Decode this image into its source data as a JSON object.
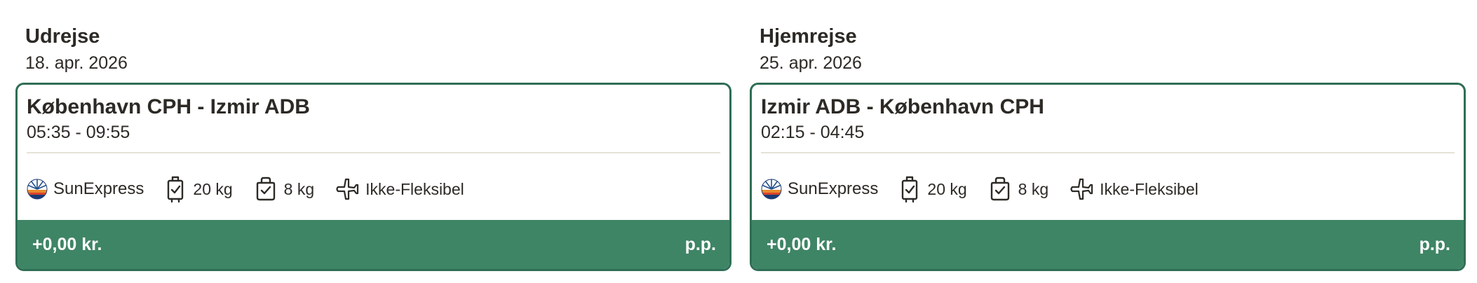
{
  "outbound": {
    "heading": "Udrejse",
    "date": "18. apr. 2026",
    "route": "København CPH - Izmir ADB",
    "times": "05:35 - 09:55",
    "airline": "SunExpress",
    "checked_baggage": "20 kg",
    "cabin_baggage": "8 kg",
    "flexibility": "Ikke-Fleksibel",
    "price": "+0,00 kr.",
    "per_person": "p.p."
  },
  "return": {
    "heading": "Hjemrejse",
    "date": "25. apr. 2026",
    "route": "Izmir ADB - København CPH",
    "times": "02:15 - 04:45",
    "airline": "SunExpress",
    "checked_baggage": "20 kg",
    "cabin_baggage": "8 kg",
    "flexibility": "Ikke-Fleksibel",
    "price": "+0,00 kr.",
    "per_person": "p.p."
  },
  "icons": {
    "airline_logo": "sunexpress-logo-icon",
    "checked_baggage": "checked-suitcase-icon",
    "cabin_baggage": "cabin-bag-icon",
    "flexibility": "plane-icon"
  },
  "colors": {
    "accent": "#3e8565",
    "border": "#2f6e55",
    "divider": "#e6e1d8",
    "text": "#2d2a26"
  }
}
